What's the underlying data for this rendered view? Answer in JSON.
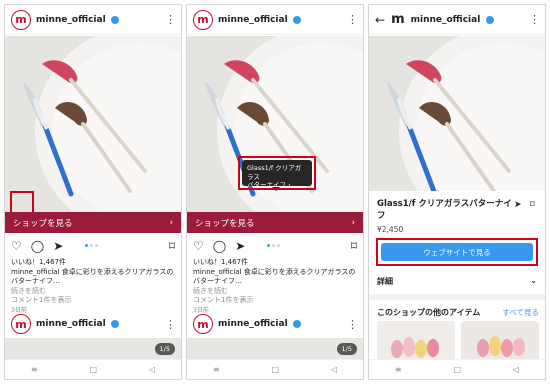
{
  "account": {
    "username": "minne_official",
    "logo_letter": "m"
  },
  "colors": {
    "accent": "#3897f0",
    "shop_bar": "#9b1b3a",
    "highlight": "#d0021b"
  },
  "post": {
    "shop_label": "ショップを見る",
    "likes": "いいね！1,467件",
    "caption": "minne_official 食卓に彩りを添えるクリアガラスのバターナイフ…",
    "caption_more": "続きを読む",
    "comments": "コメント1件を表示",
    "time": "3日前",
    "image_counter": "1/5"
  },
  "tooltip": {
    "line1": "Glass1/f クリアガラス",
    "line2": "バターナイフ ›"
  },
  "product": {
    "name": "Glass1/f クリアガラスバターナイフ",
    "price": "¥2,450",
    "website_button": "ウェブサイトで見る",
    "details_label": "詳細",
    "other_items_label": "このショップの他のアイテム",
    "see_all": "すべて見る"
  },
  "icons": {
    "heart": "heart-icon",
    "comment": "comment-icon",
    "send": "send-icon",
    "bookmark": "bookmark-icon",
    "shopping_bag": "shopping-bag-icon",
    "back": "back-arrow-icon"
  }
}
